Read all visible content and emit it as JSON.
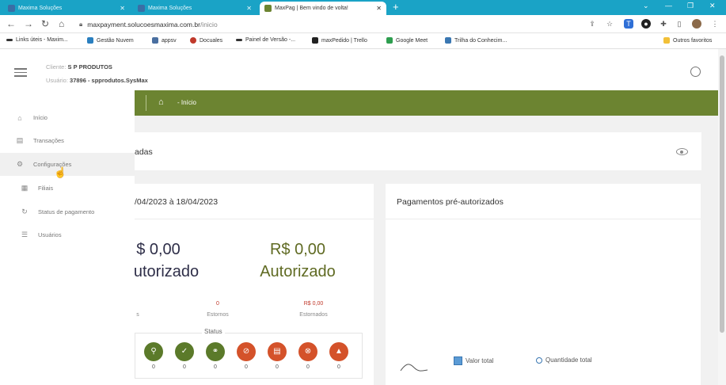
{
  "browser": {
    "tabs": [
      {
        "label": "Maxima Soluções",
        "active": false
      },
      {
        "label": "Maxima Soluções",
        "active": false
      },
      {
        "label": "MaxPag | Bem vindo de volta!",
        "active": true
      }
    ],
    "url_host": "maxpayment.solucoesmaxima.com.br",
    "url_path": "/inicio",
    "bookmarks": [
      "Links úteis - Maxim...",
      "Gestão Nuvem",
      "appsv",
      "Docuales",
      "Painel de Versão -...",
      "maxPedido | Trello",
      "Google Meet",
      "Trilha do Conhecim..."
    ],
    "other_bookmarks": "Outros favoritos"
  },
  "header": {
    "client_label": "Cliente:",
    "client_value": "S P PRODUTOS",
    "user_label": "Usuário:",
    "user_value": "37896 - spprodutos.SysMax"
  },
  "breadcrumb": {
    "current": "- Início"
  },
  "sidebar": {
    "items": [
      {
        "label": "Início",
        "icon": "home-icon"
      },
      {
        "label": "Transações",
        "icon": "document-icon"
      },
      {
        "label": "Configurações",
        "icon": "gear-icon"
      },
      {
        "label": "Filiais",
        "icon": "building-icon"
      },
      {
        "label": "Status de pagamento",
        "icon": "cycle-icon"
      },
      {
        "label": "Usuários",
        "icon": "users-icon"
      }
    ]
  },
  "cards": {
    "first_title": "adas",
    "summary": {
      "period": "/04/2023 à 18/04/2023",
      "left_amount": "$ 0,00",
      "left_label": "utorizado",
      "right_amount": "R$ 0,00",
      "right_label": "Autorizado",
      "left_small_label": "s",
      "mid_value": "0",
      "mid_label": "Estornos",
      "right_value": "R$ 0,00",
      "right_small_label": "Estornados",
      "status_title": "Status",
      "status_counts": [
        "0",
        "0",
        "0",
        "0",
        "0",
        "0",
        "0"
      ]
    },
    "preauth": {
      "title": "Pagamentos pré-autorizados",
      "legend_value": "Valor total",
      "legend_qty": "Quantidade total"
    }
  },
  "colors": {
    "tab_bar": "#1aa3c6",
    "brand_green": "#6c8431",
    "status_green": "#5b7a2a",
    "status_red": "#d4522a"
  }
}
